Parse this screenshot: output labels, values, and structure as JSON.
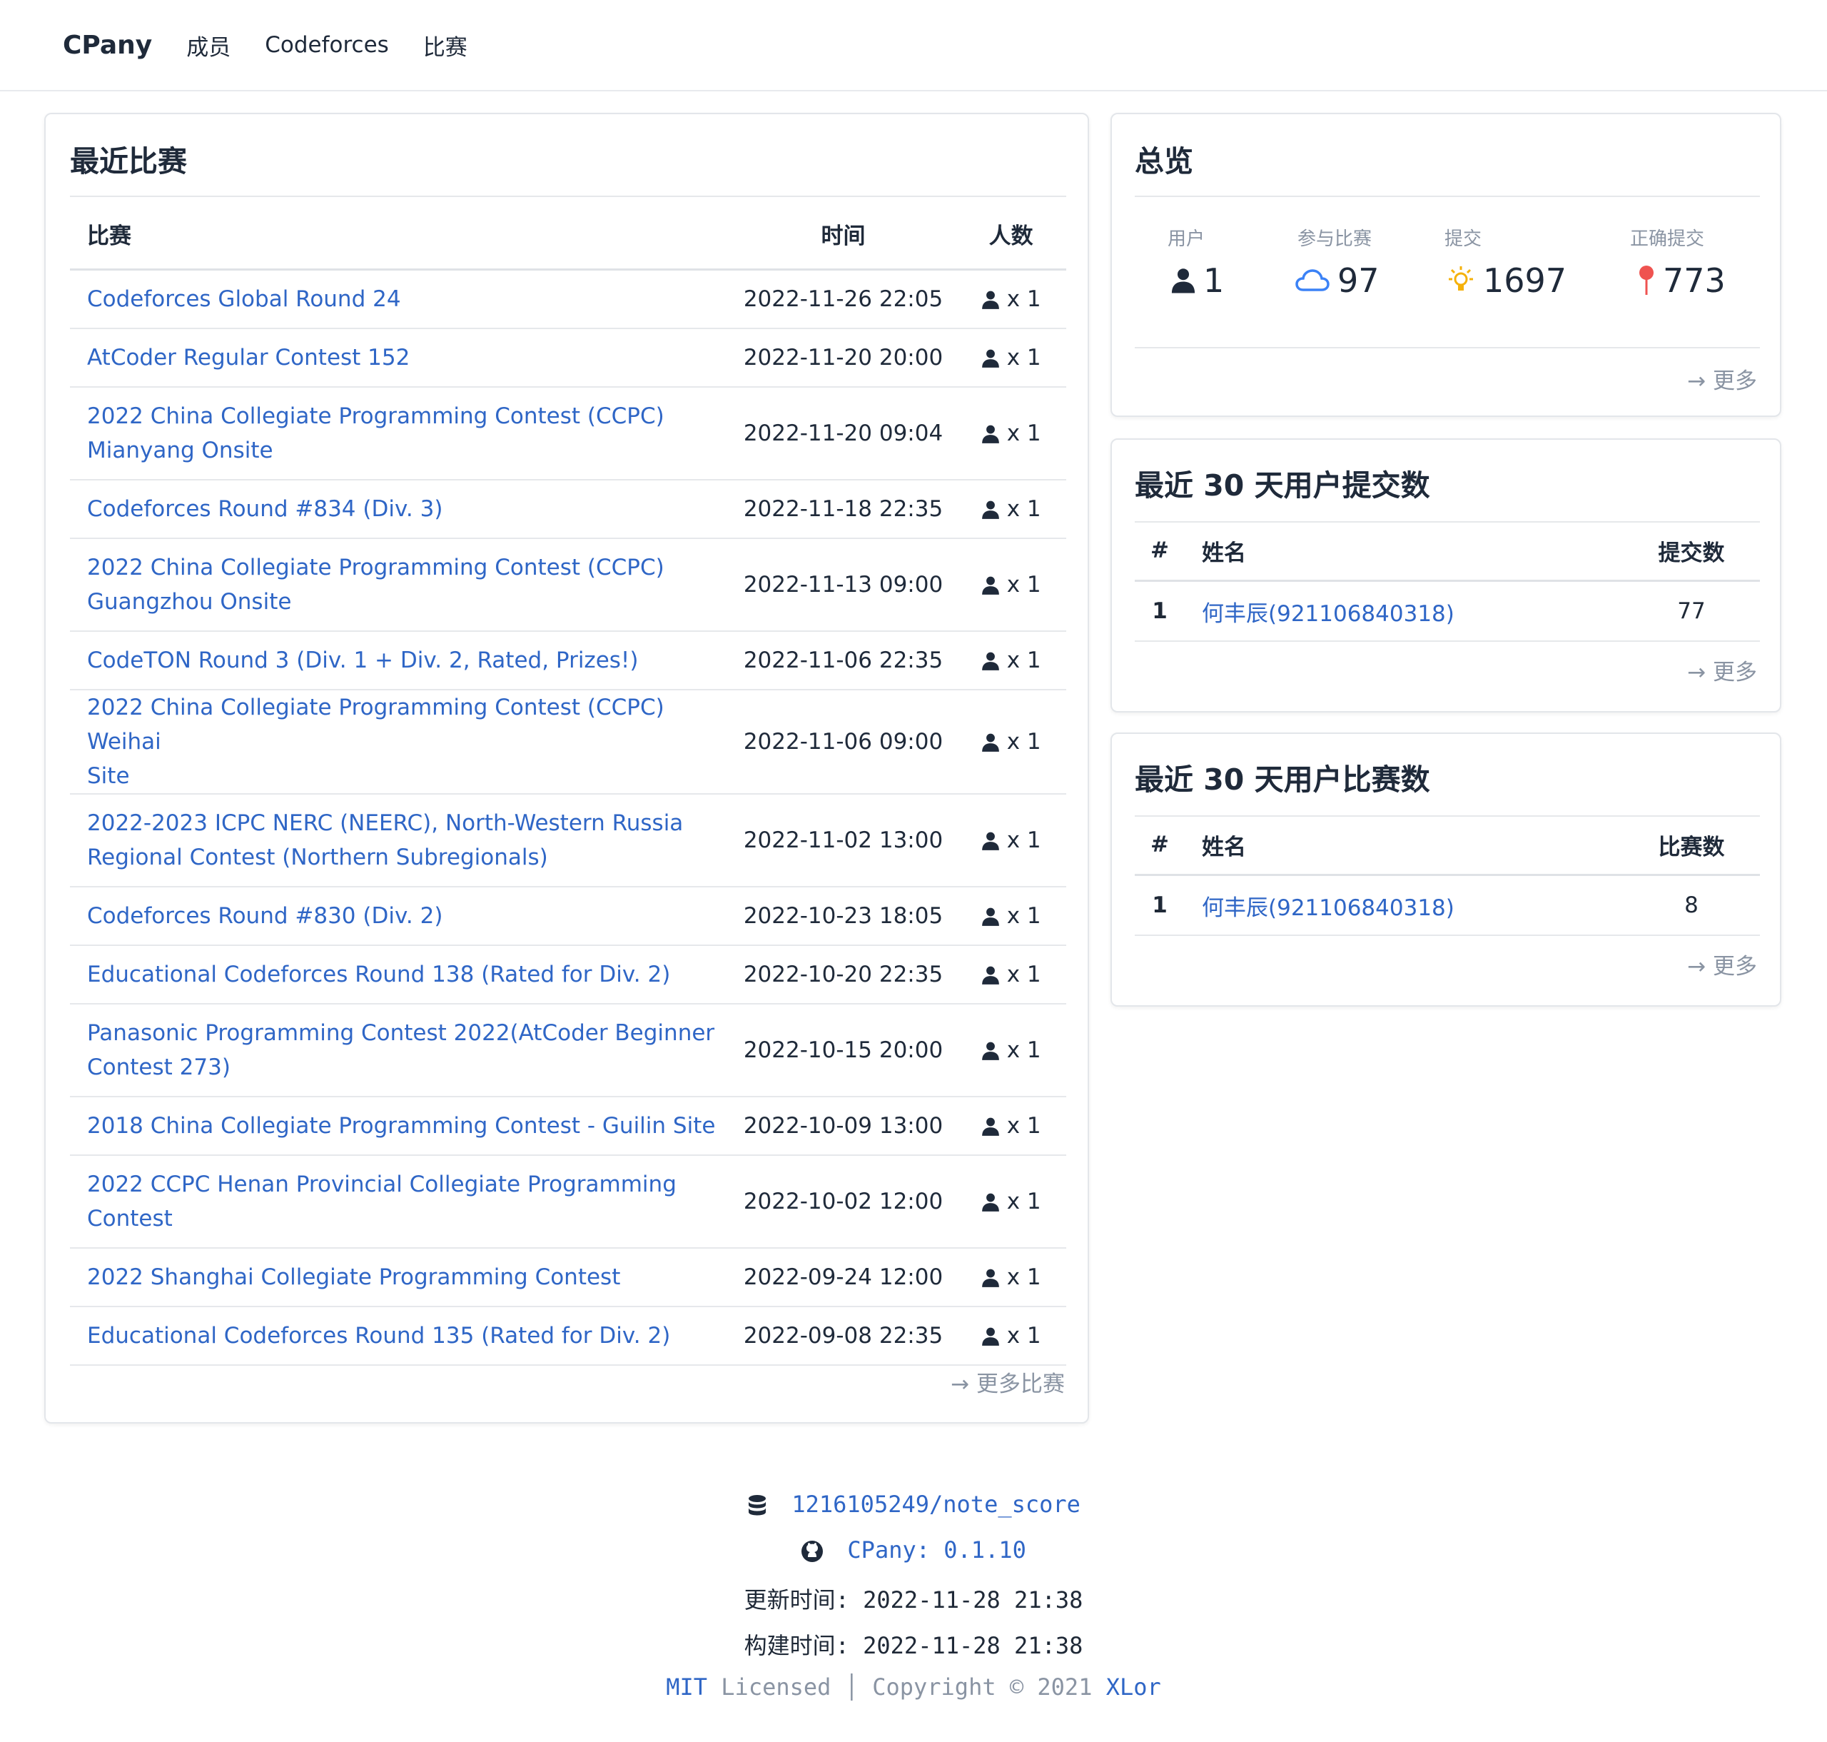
{
  "nav": {
    "brand": "CPany",
    "items": [
      "成员",
      "Codeforces",
      "比赛"
    ]
  },
  "recent_contests": {
    "title": "最近比赛",
    "headers": {
      "name": "比赛",
      "time": "时间",
      "count": "人数"
    },
    "rows": [
      {
        "name_lines": [
          "Codeforces Global Round 24"
        ],
        "time": "2022-11-26 22:05",
        "count": "x 1"
      },
      {
        "name_lines": [
          "AtCoder Regular Contest 152"
        ],
        "time": "2022-11-20 20:00",
        "count": "x 1"
      },
      {
        "name_lines": [
          "2022 China Collegiate Programming Contest (CCPC)",
          "Mianyang Onsite"
        ],
        "time": "2022-11-20 09:04",
        "count": "x 1"
      },
      {
        "name_lines": [
          "Codeforces Round #834 (Div. 3)"
        ],
        "time": "2022-11-18 22:35",
        "count": "x 1"
      },
      {
        "name_lines": [
          "2022 China Collegiate Programming Contest (CCPC)",
          "Guangzhou Onsite"
        ],
        "time": "2022-11-13 09:00",
        "count": "x 1"
      },
      {
        "name_lines": [
          "CodeTON Round 3 (Div. 1 + Div. 2, Rated, Prizes!)"
        ],
        "time": "2022-11-06 22:35",
        "count": "x 1"
      },
      {
        "name_lines": [
          "2022 China Collegiate Programming Contest (CCPC) Weihai",
          "Site"
        ],
        "time": "2022-11-06 09:00",
        "count": "x 1"
      },
      {
        "name_lines": [
          "2022-2023 ICPC NERC (NEERC), North-Western Russia",
          "Regional Contest (Northern Subregionals)"
        ],
        "time": "2022-11-02 13:00",
        "count": "x 1"
      },
      {
        "name_lines": [
          "Codeforces Round #830 (Div. 2)"
        ],
        "time": "2022-10-23 18:05",
        "count": "x 1"
      },
      {
        "name_lines": [
          "Educational Codeforces Round 138 (Rated for Div. 2)"
        ],
        "time": "2022-10-20 22:35",
        "count": "x 1"
      },
      {
        "name_lines": [
          "Panasonic Programming Contest 2022(AtCoder Beginner",
          "Contest 273)"
        ],
        "time": "2022-10-15 20:00",
        "count": "x 1"
      },
      {
        "name_lines": [
          "2018 China Collegiate Programming Contest - Guilin Site"
        ],
        "time": "2022-10-09 13:00",
        "count": "x 1"
      },
      {
        "name_lines": [
          "2022 CCPC Henan Provincial Collegiate Programming",
          "Contest"
        ],
        "time": "2022-10-02 12:00",
        "count": "x 1"
      },
      {
        "name_lines": [
          "2022 Shanghai Collegiate Programming Contest"
        ],
        "time": "2022-09-24 12:00",
        "count": "x 1"
      },
      {
        "name_lines": [
          "Educational Codeforces Round 135 (Rated for Div. 2)"
        ],
        "time": "2022-09-08 22:35",
        "count": "x 1"
      }
    ],
    "more": "→ 更多比赛"
  },
  "overview": {
    "title": "总览",
    "stats": [
      {
        "label": "用户",
        "value": "1",
        "icon": "person-icon"
      },
      {
        "label": "参与比赛",
        "value": "97",
        "icon": "cloud-icon"
      },
      {
        "label": "提交",
        "value": "1697",
        "icon": "lightbulb-icon"
      },
      {
        "label": "正确提交",
        "value": "773",
        "icon": "pin-icon"
      }
    ],
    "more": "→ 更多"
  },
  "submissions_30d": {
    "title": "最近 30 天用户提交数",
    "headers": {
      "rank": "#",
      "name": "姓名",
      "value": "提交数"
    },
    "rows": [
      {
        "rank": "1",
        "name": "何丰辰(921106840318)",
        "value": "77"
      }
    ],
    "more": "→ 更多"
  },
  "contests_30d": {
    "title": "最近 30 天用户比赛数",
    "headers": {
      "rank": "#",
      "name": "姓名",
      "value": "比赛数"
    },
    "rows": [
      {
        "rank": "1",
        "name": "何丰辰(921106840318)",
        "value": "8"
      }
    ],
    "more": "→ 更多"
  },
  "footer": {
    "repo": "1216105249/note_score",
    "version": "CPany: 0.1.10",
    "updated": "更新时间: 2022-11-28 21:38",
    "built": "构建时间: 2022-11-28 21:38",
    "license_link": "MIT",
    "license_text": " Licensed │ Copyright © 2021 ",
    "author": "XLor"
  },
  "colors": {
    "link": "#2f66c6",
    "muted": "#8a94a3",
    "text": "#1f2a3a",
    "cloud": "#3b82f6",
    "bulb": "#f5b10a",
    "pin": "#ef5350"
  }
}
